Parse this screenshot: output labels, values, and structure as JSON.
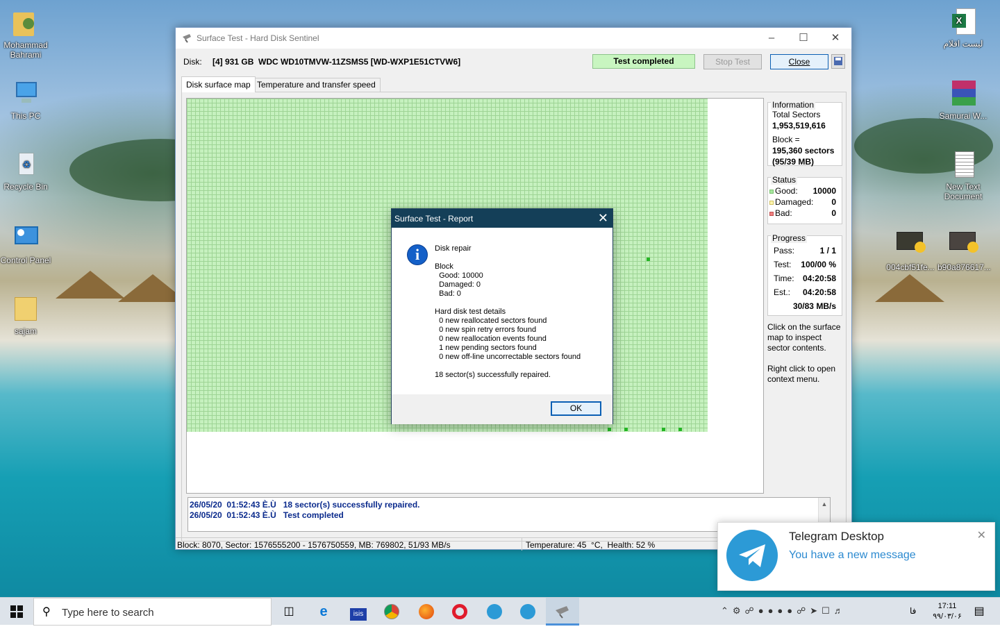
{
  "desktop": {
    "icons_left": [
      {
        "label": "Mohammad Bahrami",
        "icon": "user-folder-icon"
      },
      {
        "label": "This PC",
        "icon": "computer-icon"
      },
      {
        "label": "Recycle Bin",
        "icon": "recycle-bin-icon"
      },
      {
        "label": "Control Panel",
        "icon": "control-panel-icon"
      },
      {
        "label": "sajam",
        "icon": "folder-icon"
      }
    ],
    "icons_right": [
      {
        "label": "لیست اقلام",
        "icon": "excel-file-icon"
      },
      {
        "label": "Samurai W...",
        "icon": "winrar-archive-icon"
      },
      {
        "label": "New Text Document",
        "icon": "text-document-icon"
      },
      {
        "label": "004cbf51fe...",
        "icon": "video-file-icon"
      },
      {
        "label": "b90a876617...",
        "icon": "video-file-icon"
      }
    ]
  },
  "window": {
    "title": "Surface Test - Hard Disk Sentinel",
    "disk_label": "Disk:",
    "disk_value": "[4] 931 GB  WDC WD10TMVW-11ZSMS5 [WD-WXP1E51CTVW6]",
    "status_badge": "Test completed",
    "stop_button": "Stop Test",
    "close_button": "Close",
    "tabs": [
      "Disk surface map",
      "Temperature and transfer speed"
    ],
    "log": [
      "26/05/20  01:52:43 È.Ù   18 sector(s) successfully repaired.",
      "26/05/20  01:52:43 È.Ù   Test completed"
    ],
    "statusbar_left": "Block: 8070, Sector: 1576555200 - 1576750559, MB: 769802, 51/93 MB/s",
    "statusbar_right": "Temperature: 45  °C,  Health: 52 %"
  },
  "info": {
    "heading": "Information",
    "total_sectors_label": "Total Sectors",
    "total_sectors": "1,953,519,616",
    "block_label": "Block =",
    "block_value": "195,360 sectors",
    "block_mb": "(95/39 MB)"
  },
  "status": {
    "heading": "Status",
    "good_label": "Good:",
    "good": "10000",
    "damaged_label": "Damaged:",
    "damaged": "0",
    "bad_label": "Bad:",
    "bad": "0"
  },
  "progress": {
    "heading": "Progress",
    "pass_label": "Pass:",
    "pass": "1 / 1",
    "test_label": "Test:",
    "test": "100/00 %",
    "time_label": "Time:",
    "time": "04:20:58",
    "est_label": "Est.:",
    "est": "04:20:58",
    "speed": "30/83 MB/s"
  },
  "hints": {
    "hint1": "Click on the surface map to inspect sector contents.",
    "hint2": "Right click to open context menu."
  },
  "dialog": {
    "title": "Surface Test - Report",
    "lines": [
      "Disk repair",
      "Block",
      "  Good: 10000",
      "  Damaged: 0",
      "  Bad: 0",
      "Hard disk test details",
      "  0 new reallocated sectors found",
      "  0 new spin retry errors found",
      "  0 new reallocation events found",
      "  1 new pending sectors found",
      "  0 new off-line uncorrectable sectors found",
      "18 sector(s) successfully repaired."
    ],
    "ok_button": "OK"
  },
  "toast": {
    "app": "Telegram Desktop",
    "message": "You have a new message"
  },
  "taskbar": {
    "search_placeholder": "Type here to search",
    "time": "17:11",
    "date": "۹۹/۰۳/۰۶",
    "lang": "فا"
  },
  "colors": {
    "map_good": "#c6f1bf",
    "status_badge_bg": "#c8f5c0",
    "dialog_title_bg": "#143f58",
    "log_text": "#0a2a8c",
    "telegram": "#2c9ad6"
  }
}
